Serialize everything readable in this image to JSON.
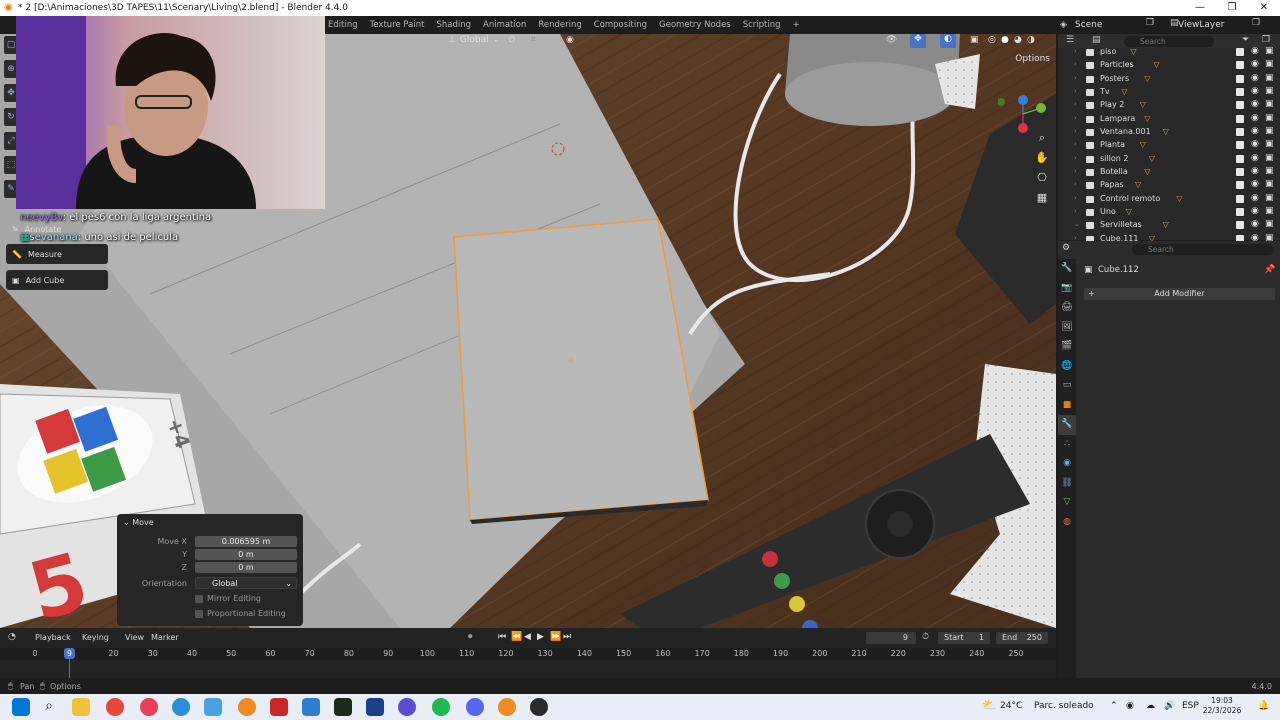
{
  "window": {
    "title": "* 2 [D:\\Animaciones\\3D TAPES\\11\\Scenary\\Living\\2.blend] - Blender 4.4.0",
    "controls": [
      "—",
      "❐",
      "✕"
    ]
  },
  "workspaces": [
    "Editing",
    "Texture Paint",
    "Shading",
    "Animation",
    "Rendering",
    "Compositing",
    "Geometry Nodes",
    "Scripting",
    "+"
  ],
  "scene": {
    "name": "Scene",
    "view_layer": "ViewLayer"
  },
  "viewport": {
    "orientation": "Global",
    "options_label": "Options"
  },
  "tools": {
    "annotate": "Annotate",
    "measure": "Measure",
    "add_cube": "Add Cube"
  },
  "chat": [
    {
      "user": "neevyBv",
      "message": ": el pes6 con la liga argentina"
    },
    {
      "user": "sevanana",
      "message": ": uno asi de pelicula"
    }
  ],
  "move_panel": {
    "title": "Move",
    "move_x_label": "Move X",
    "move_x": "0.006595 m",
    "y_label": "Y",
    "y": "0 m",
    "z_label": "Z",
    "z": "0 m",
    "orientation_label": "Orientation",
    "orientation": "Global",
    "mirror_editing": "Mirror Editing",
    "proportional_editing": "Proportional Editing"
  },
  "outliner": {
    "search_placeholder": "Search",
    "items": [
      {
        "name": "piso",
        "sub": ""
      },
      {
        "name": "Particles",
        "sub": "2"
      },
      {
        "name": "Posters",
        "sub": "2"
      },
      {
        "name": "Tv",
        "sub": "2"
      },
      {
        "name": "Play 2",
        "sub": "2"
      },
      {
        "name": "Lampara",
        "sub": "3"
      },
      {
        "name": "Ventana.001",
        "sub": ""
      },
      {
        "name": "Planta",
        "sub": "2"
      },
      {
        "name": "sillon 2",
        "sub": ""
      },
      {
        "name": "Botella",
        "sub": "3"
      },
      {
        "name": "Papas",
        "sub": "3"
      },
      {
        "name": "Control remoto",
        "sub": ""
      },
      {
        "name": "Uno",
        "sub": "2"
      },
      {
        "name": "Servilletas",
        "sub": ""
      },
      {
        "name": "Cube.111",
        "sub": ""
      }
    ]
  },
  "properties": {
    "search_placeholder": "Search",
    "object_name": "Cube.112",
    "add_modifier": "Add Modifier"
  },
  "timeline": {
    "menus": [
      "Playback",
      "Keying",
      "View",
      "Marker"
    ],
    "current_frame": "9",
    "start_label": "Start",
    "start": "1",
    "end_label": "End",
    "end": "250",
    "ticks": [
      "0",
      "20",
      "30",
      "40",
      "50",
      "60",
      "70",
      "80",
      "90",
      "100",
      "110",
      "120",
      "130",
      "140",
      "150",
      "160",
      "170",
      "180",
      "190",
      "200",
      "210",
      "220",
      "230",
      "240",
      "250"
    ]
  },
  "status": {
    "left1": "Pan",
    "left2": "Options",
    "version": "4.4.0"
  },
  "taskbar": {
    "weather_temp": "24°C",
    "weather_desc": "Parc. soleado",
    "lang": "ESP",
    "time": "19:03",
    "date": "22/3/2026"
  },
  "colors": {
    "selection_outline": "#f29b38",
    "accent_blue": "#4773c4",
    "wood": "#6b4a2f"
  }
}
